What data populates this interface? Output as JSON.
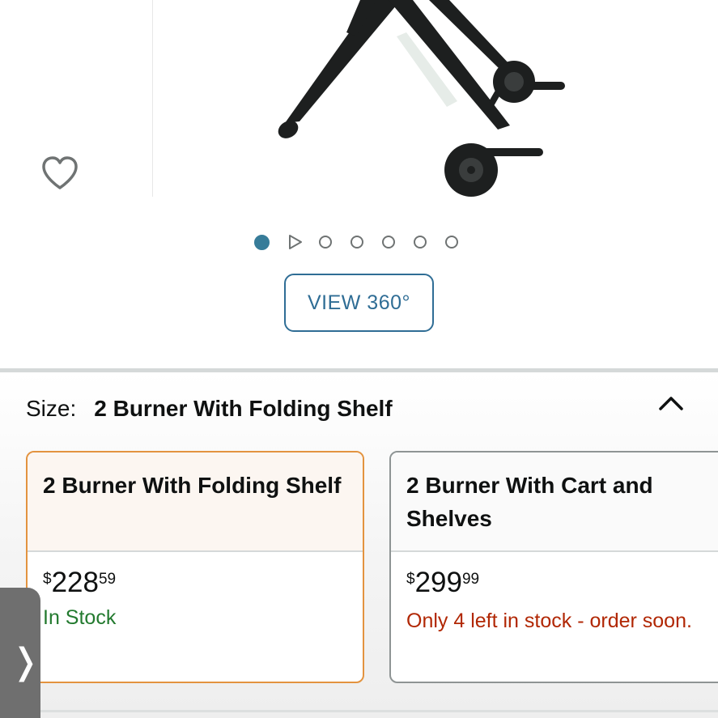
{
  "gallery": {
    "image_alt": "grill cart with folding legs and wheels",
    "dot_count": 7,
    "active_dot": 0,
    "view360_label": "VIEW 360°"
  },
  "size": {
    "label": "Size:",
    "selected_value": "2 Burner With Folding Shelf",
    "options": [
      {
        "name": "2 Burner With Folding Shelf",
        "price_symbol": "$",
        "price_whole": "228",
        "price_fraction": "59",
        "availability": "In Stock",
        "selected": true
      },
      {
        "name": "2 Burner With Cart and Shelves",
        "price_symbol": "$",
        "price_whole": "299",
        "price_fraction": "99",
        "availability": "Only 4 left in stock - order soon.",
        "selected": false
      }
    ]
  },
  "side_tab": {
    "glyph": "❭"
  },
  "colors": {
    "accent": "#2f6d95",
    "selected_border": "#e3933f",
    "in_stock": "#237a2f",
    "low_stock": "#b12704"
  }
}
